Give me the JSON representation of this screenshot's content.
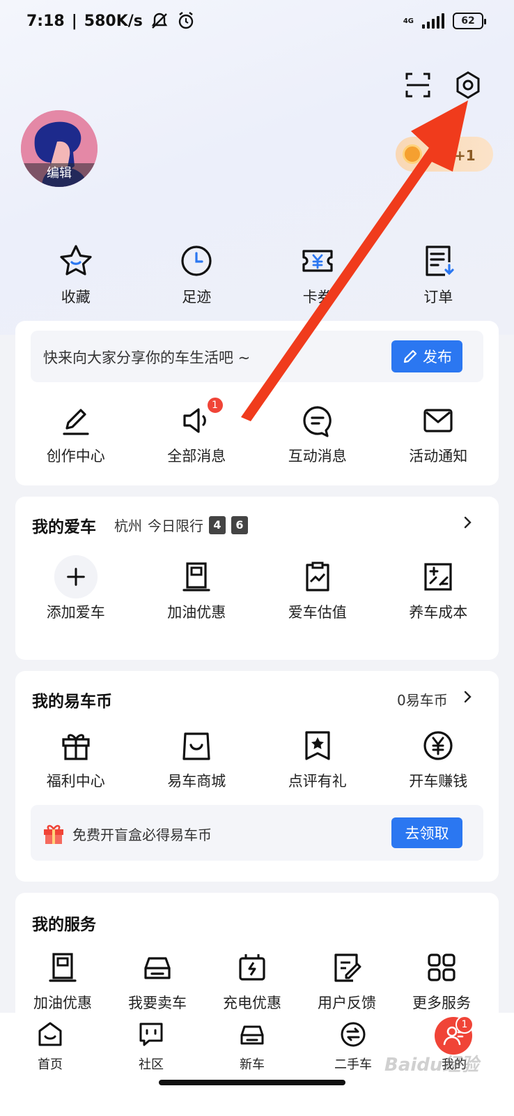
{
  "status_bar": {
    "time": "7:18",
    "speed": "580K/s",
    "network": "4G",
    "battery": "62"
  },
  "profile": {
    "avatar_edit_label": "编辑",
    "signin_label": "签到+1"
  },
  "quick_actions": [
    {
      "label": "收藏",
      "icon": "star-icon"
    },
    {
      "label": "足迹",
      "icon": "clock-icon"
    },
    {
      "label": "卡券",
      "icon": "coupon-icon"
    },
    {
      "label": "订单",
      "icon": "order-icon"
    }
  ],
  "community": {
    "share_prompt": "快来向大家分享你的车生活吧 ~",
    "publish_label": "发布",
    "items": [
      {
        "label": "创作中心",
        "icon": "pen-icon"
      },
      {
        "label": "全部消息",
        "icon": "speaker-icon",
        "badge": "1"
      },
      {
        "label": "互动消息",
        "icon": "chat-icon"
      },
      {
        "label": "活动通知",
        "icon": "mail-icon"
      }
    ]
  },
  "my_car": {
    "title": "我的爱车",
    "city": "杭州",
    "restriction_label": "今日限行",
    "restriction_numbers": [
      "4",
      "6"
    ],
    "items": [
      {
        "label": "添加爱车",
        "icon": "plus-icon"
      },
      {
        "label": "加油优惠",
        "icon": "fuel-icon"
      },
      {
        "label": "爱车估值",
        "icon": "valuation-icon"
      },
      {
        "label": "养车成本",
        "icon": "cost-icon"
      }
    ]
  },
  "coins": {
    "title": "我的易车币",
    "balance": "0易车币",
    "items": [
      {
        "label": "福利中心",
        "icon": "gift-icon"
      },
      {
        "label": "易车商城",
        "icon": "shopping-bag-icon"
      },
      {
        "label": "点评有礼",
        "icon": "review-star-icon"
      },
      {
        "label": "开车赚钱",
        "icon": "yuan-coin-icon"
      }
    ],
    "promo_text": "免费开盲盒必得易车币",
    "promo_button": "去领取"
  },
  "services": {
    "title": "我的服务",
    "items": [
      {
        "label": "加油优惠",
        "icon": "fuel-icon"
      },
      {
        "label": "我要卖车",
        "icon": "car-icon"
      },
      {
        "label": "充电优惠",
        "icon": "charging-icon"
      },
      {
        "label": "用户反馈",
        "icon": "feedback-icon"
      },
      {
        "label": "更多服务",
        "icon": "grid-icon"
      }
    ]
  },
  "tabbar": [
    {
      "label": "首页",
      "icon": "home-icon"
    },
    {
      "label": "社区",
      "icon": "community-icon"
    },
    {
      "label": "新车",
      "icon": "new-car-icon"
    },
    {
      "label": "二手车",
      "icon": "used-car-icon"
    },
    {
      "label": "我的",
      "icon": "profile-icon",
      "badge": "1"
    }
  ],
  "watermark": "Baidu经验",
  "colors": {
    "accent": "#2b77f1",
    "badge": "#f04437",
    "annotation_arrow": "#f03b1c"
  }
}
